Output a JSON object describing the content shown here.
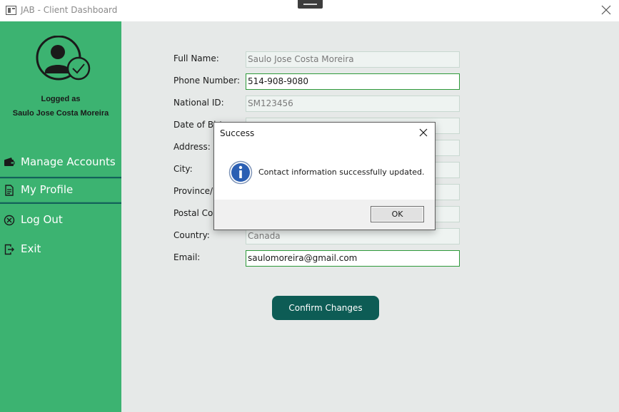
{
  "window": {
    "title": "JAB - Client Dashboard",
    "close_icon": "close-icon",
    "drag_icon": "drag-handle-icon"
  },
  "sidebar": {
    "logged_as_label": "Logged as",
    "logged_user": "Saulo Jose Costa Moreira",
    "avatar_icon": "user-check-icon",
    "items": [
      {
        "label": "Manage Accounts",
        "icon": "wallet-icon"
      },
      {
        "label": "My Profile",
        "icon": "document-icon"
      },
      {
        "label": "Log Out",
        "icon": "circle-x-icon"
      },
      {
        "label": "Exit",
        "icon": "exit-icon"
      }
    ],
    "active_item": "My Profile"
  },
  "form": {
    "full_name": {
      "label": "Full Name:",
      "value": "Saulo Jose Costa Moreira"
    },
    "phone": {
      "label": "Phone Number:",
      "value": "514-908-9080"
    },
    "national_id": {
      "label": "National ID:",
      "value": "SM123456"
    },
    "dob": {
      "label": "Date of Birt",
      "value": ""
    },
    "address": {
      "label": "Address:",
      "value": ""
    },
    "city": {
      "label": "City:",
      "value": ""
    },
    "province": {
      "label": "Province/S",
      "value": ""
    },
    "postal": {
      "label": "Postal Cod",
      "value": ""
    },
    "country": {
      "label": "Country:",
      "value": "Canada"
    },
    "email": {
      "label": "Email:",
      "value": "saulomoreira@gmail.com"
    },
    "confirm_button": "Confirm Changes"
  },
  "dialog": {
    "title": "Success",
    "message": "Contact information successfully updated.",
    "ok_label": "OK",
    "icon": "info-icon"
  },
  "colors": {
    "sidebar": "#3cb371",
    "main_bg": "#e6e9e8",
    "confirm_button": "#0d5c55",
    "editable_border": "#2e9a3a"
  }
}
